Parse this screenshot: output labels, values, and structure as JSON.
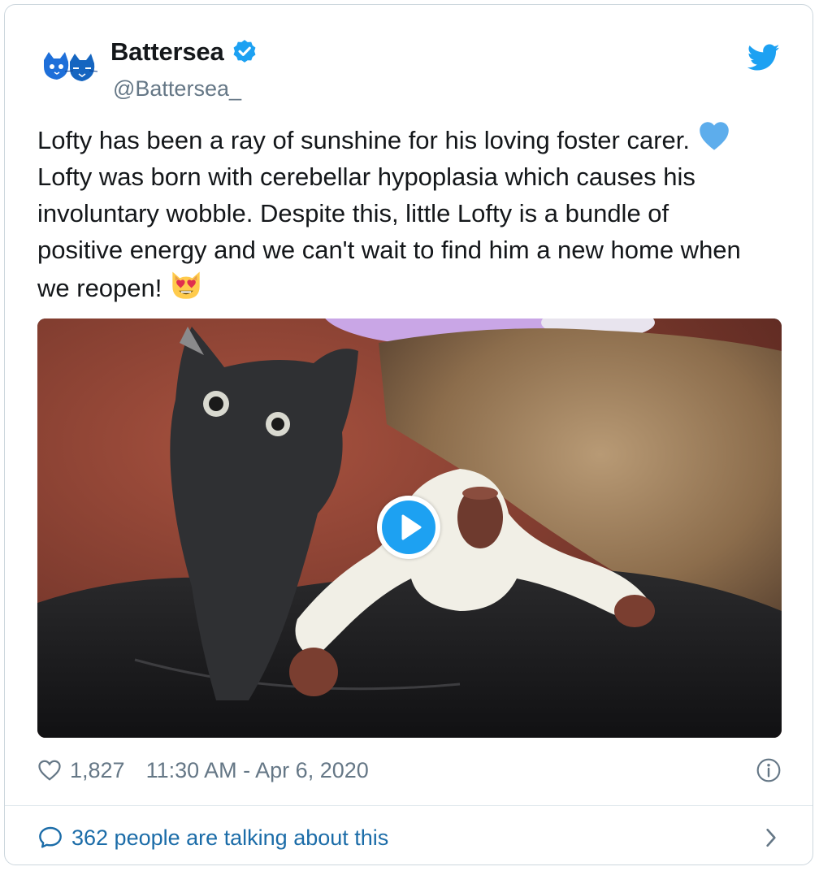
{
  "account": {
    "display_name": "Battersea",
    "handle": "@Battersea_",
    "verified": true,
    "avatar_icon": "two-cat-faces-icon"
  },
  "tweet": {
    "lines": [
      "Lofty has been a ray of sunshine for his loving foster carer.",
      "Lofty was born with cerebellar hypoplasia which causes his",
      "involuntary wobble. Despite this, little Lofty is a bundle of",
      "positive energy and we can't wait to find him a new home when",
      "we reopen!"
    ],
    "emojis": [
      "blue-heart-icon",
      "heart-eyes-cat-icon"
    ]
  },
  "media": {
    "type": "video",
    "play_icon": "play-icon"
  },
  "footer": {
    "likes": "1,827",
    "timestamp": "11:30 AM - Apr 6, 2020",
    "talking": "362 people are talking about this"
  },
  "colors": {
    "brand_blue": "#1da1f2",
    "link_blue": "#1b6ca8",
    "muted": "#657786",
    "border": "#ccd6dd"
  }
}
